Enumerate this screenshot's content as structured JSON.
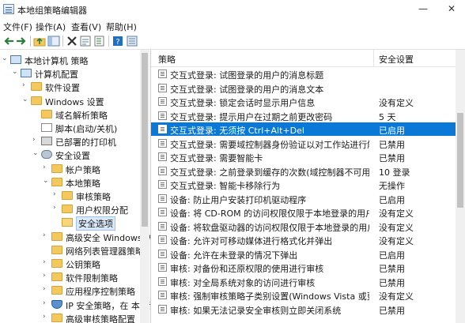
{
  "window": {
    "title": "本地组策略编辑器",
    "minimize": "—",
    "close": "✕"
  },
  "menu": [
    "文件(F)",
    "操作(A)",
    "查看(V)",
    "帮助(H)"
  ],
  "toolbar": [
    "back-icon",
    "forward-icon",
    "up-folder-icon",
    "show-hide-tree-icon",
    "delete-icon",
    "properties-icon",
    "export-list-icon",
    "help-icon",
    "view-icon"
  ],
  "tree": [
    {
      "label": "本地计算机 策略",
      "indent": 0,
      "expanded": true,
      "icon": "computer"
    },
    {
      "label": "计算机配置",
      "indent": 1,
      "expanded": true,
      "icon": "computer"
    },
    {
      "label": "软件设置",
      "indent": 2,
      "expanded": false,
      "icon": "folder"
    },
    {
      "label": "Windows 设置",
      "indent": 2,
      "expanded": true,
      "icon": "folder"
    },
    {
      "label": "域名解析策略",
      "indent": 3,
      "expanded": null,
      "icon": "folder"
    },
    {
      "label": "脚本(启动/关机)",
      "indent": 3,
      "expanded": null,
      "icon": "doc"
    },
    {
      "label": "已部署的打印机",
      "indent": 3,
      "expanded": false,
      "icon": "printer"
    },
    {
      "label": "安全设置",
      "indent": 3,
      "expanded": true,
      "icon": "gear"
    },
    {
      "label": "帐户策略",
      "indent": 4,
      "expanded": false,
      "icon": "folder"
    },
    {
      "label": "本地策略",
      "indent": 4,
      "expanded": true,
      "icon": "folder"
    },
    {
      "label": "审核策略",
      "indent": 5,
      "expanded": false,
      "icon": "folder"
    },
    {
      "label": "用户权限分配",
      "indent": 5,
      "expanded": false,
      "icon": "folder"
    },
    {
      "label": "安全选项",
      "indent": 5,
      "expanded": null,
      "icon": "folder-open",
      "selected": true
    },
    {
      "label": "高级安全 Windows 防火",
      "indent": 4,
      "expanded": false,
      "icon": "folder"
    },
    {
      "label": "网络列表管理器策略",
      "indent": 4,
      "expanded": null,
      "icon": "folder"
    },
    {
      "label": "公钥策略",
      "indent": 4,
      "expanded": false,
      "icon": "folder"
    },
    {
      "label": "软件限制策略",
      "indent": 4,
      "expanded": false,
      "icon": "folder"
    },
    {
      "label": "应用程序控制策略",
      "indent": 4,
      "expanded": false,
      "icon": "folder"
    },
    {
      "label": "IP 安全策略，在 本地计",
      "indent": 4,
      "expanded": false,
      "icon": "shield"
    },
    {
      "label": "高级审核策略配置",
      "indent": 4,
      "expanded": false,
      "icon": "folder"
    }
  ],
  "columns": {
    "policy": "策略",
    "setting": "安全设置"
  },
  "rows": [
    {
      "policy": "交互式登录: 试图登录的用户的消息标题",
      "setting": ""
    },
    {
      "policy": "交互式登录: 试图登录的用户的消息文本",
      "setting": ""
    },
    {
      "policy": "交互式登录: 锁定会话时显示用户信息",
      "setting": "没有定义"
    },
    {
      "policy": "交互式登录: 提示用户在过期之前更改密码",
      "setting": "5 天"
    },
    {
      "policy": "交互式登录: 无须按 Ctrl+Alt+Del",
      "setting": "已启用",
      "selected": true
    },
    {
      "policy": "交互式登录: 需要域控制器身份验证以对工作站进行解锁",
      "setting": "已禁用"
    },
    {
      "policy": "交互式登录: 需要智能卡",
      "setting": "已禁用"
    },
    {
      "policy": "交互式登录: 之前登录到缓存的次数(域控制器不可用时)",
      "setting": "10 登录"
    },
    {
      "policy": "交互式登录: 智能卡移除行为",
      "setting": "无操作"
    },
    {
      "policy": "设备: 防止用户安装打印机驱动程序",
      "setting": "已启用"
    },
    {
      "policy": "设备: 将 CD-ROM 的访问权限仅限于本地登录的用户",
      "setting": "没有定义"
    },
    {
      "policy": "设备: 将软盘驱动器的访问权限仅限于本地登录的用户",
      "setting": "没有定义"
    },
    {
      "policy": "设备: 允许对可移动媒体进行格式化并弹出",
      "setting": "没有定义"
    },
    {
      "policy": "设备: 允许在未登录的情况下弹出",
      "setting": "已启用"
    },
    {
      "policy": "审核: 对备份和还原权限的使用进行审核",
      "setting": "已禁用"
    },
    {
      "policy": "审核: 对全局系统对象的访问进行审核",
      "setting": "已禁用"
    },
    {
      "policy": "审核: 强制审核策略子类别设置(Windows Vista 或更高版本...",
      "setting": "没有定义"
    },
    {
      "policy": "审核: 如果无法记录安全审核则立即关闭系统",
      "setting": "已禁用"
    }
  ]
}
